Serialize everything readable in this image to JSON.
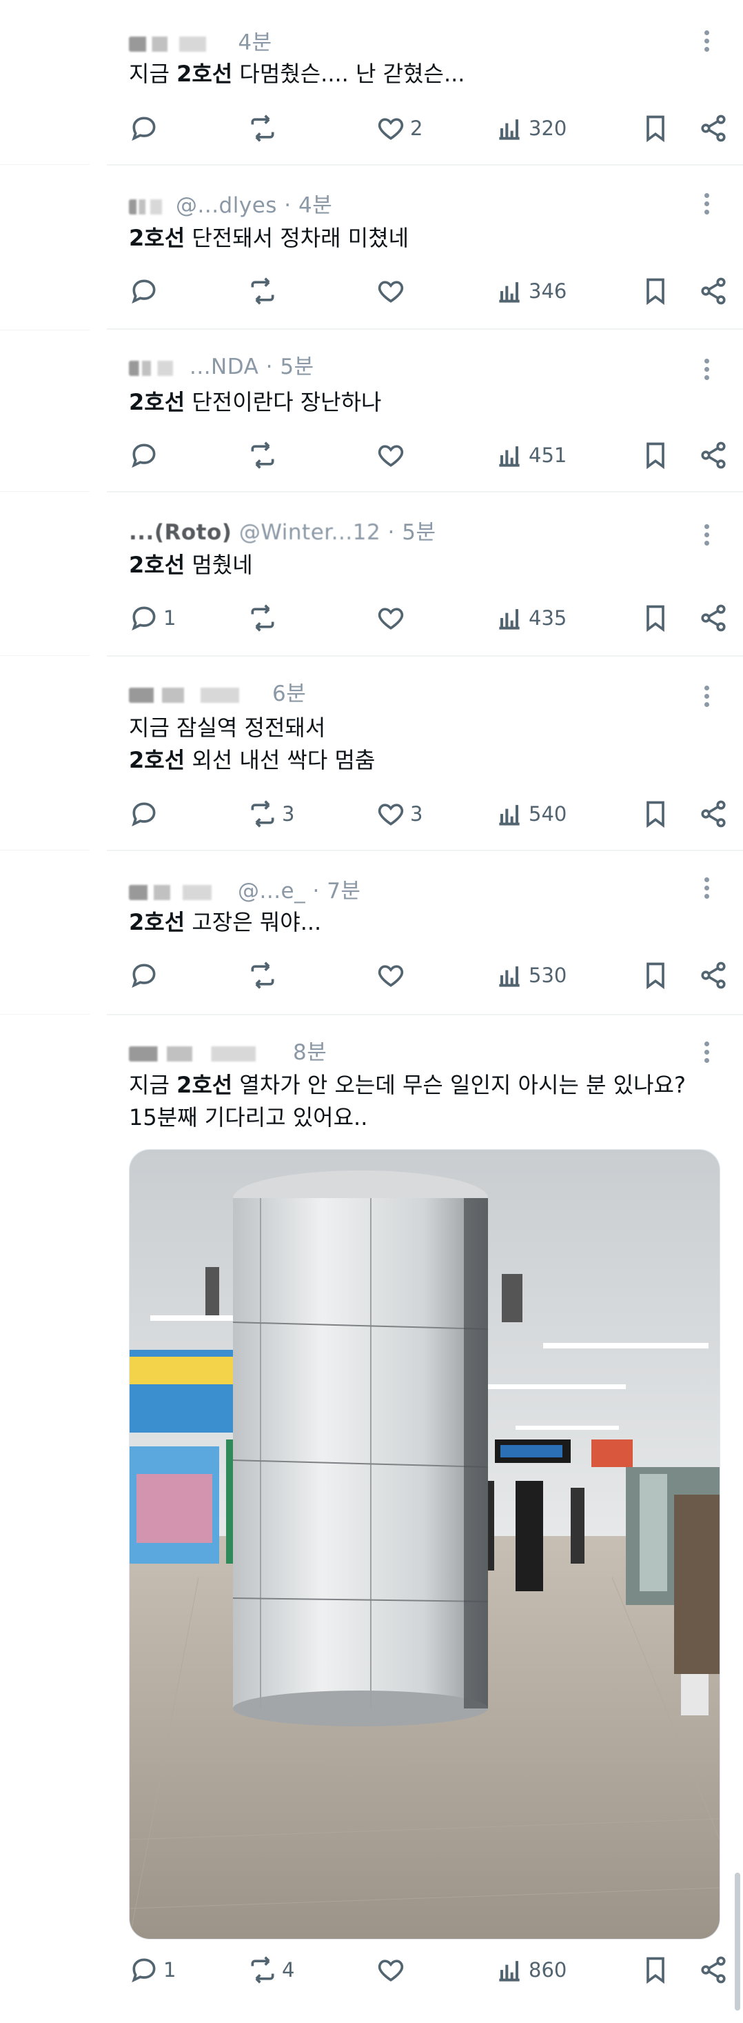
{
  "tweets": [
    {
      "time": "4분",
      "text_pre": "지금 ",
      "highlight": "2호선",
      "text_post": " 다멈췄슨.... 난 갇혔슨...",
      "replies": "",
      "retweets": "",
      "likes": "2",
      "views": "320"
    },
    {
      "handle": "@...dlyes",
      "time": "4분",
      "text_pre": "",
      "highlight": "2호선",
      "text_post": " 단전돼서 정차래 미쳤네",
      "replies": "",
      "retweets": "",
      "likes": "",
      "views": "346"
    },
    {
      "handle": "...NDA",
      "time": "5분",
      "text_pre": "",
      "highlight": "2호선",
      "text_post": " 단전이란다 장난하나",
      "replies": "",
      "retweets": "",
      "likes": "",
      "views": "451"
    },
    {
      "name": "...(Roto)",
      "handle": "@Winter...12",
      "time": "5분",
      "text_pre": "",
      "highlight": "2호선",
      "text_post": " 멈췄네",
      "replies": "1",
      "retweets": "",
      "likes": "",
      "views": "435"
    },
    {
      "time": "6분",
      "line1": "지금 잠실역 정전돼서",
      "text_pre": "",
      "highlight": "2호선",
      "text_post": " 외선 내선 싹다 멈춤",
      "replies": "",
      "retweets": "3",
      "likes": "3",
      "views": "540"
    },
    {
      "handle": "@...e_",
      "time": "7분",
      "text_pre": "",
      "highlight": "2호선",
      "text_post": " 고장은 뭐야...",
      "replies": "",
      "retweets": "",
      "likes": "",
      "views": "530"
    },
    {
      "time": "8분",
      "text_pre": "지금 ",
      "highlight": "2호선",
      "text_post": " 열차가 안 오는데 무슨 일인지 아시는 분 있나요?",
      "line2": "15분째 기다리고 있어요..",
      "replies": "1",
      "retweets": "4",
      "likes": "",
      "views": "860"
    }
  ],
  "icons": {
    "reply": "reply-icon",
    "retweet": "retweet-icon",
    "like": "heart-icon",
    "views": "views-icon",
    "bookmark": "bookmark-icon",
    "share": "share-icon",
    "more": "more-icon"
  },
  "colors": {
    "text": "#0f1419",
    "secondary": "#536471",
    "meta": "#8b98a5",
    "divider": "#eff3f4"
  }
}
